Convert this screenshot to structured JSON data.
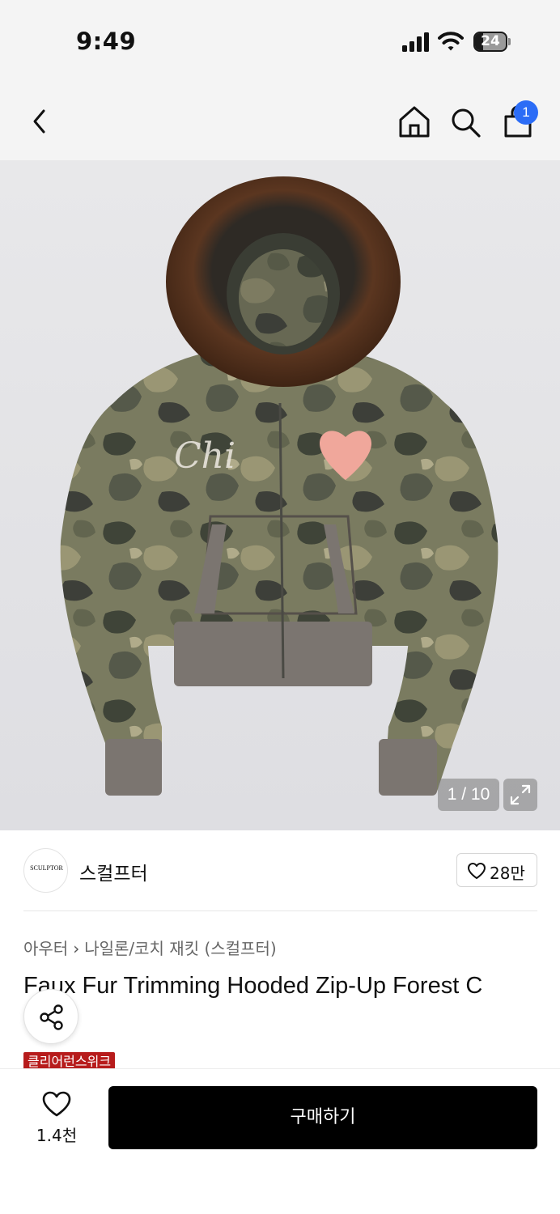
{
  "status_bar": {
    "time": "9:49",
    "battery_level": "24",
    "icons": [
      "cellular-signal-icon",
      "wifi-icon",
      "battery-icon"
    ]
  },
  "nav": {
    "icons": [
      "back-icon",
      "home-icon",
      "search-icon",
      "shopping-bag-icon"
    ],
    "cart_count": "1"
  },
  "gallery": {
    "counter": "1 / 10",
    "image_description_icon": "camo-fur-hooded-jacket-image",
    "expand_icon": "expand-icon",
    "print_text": "Chi"
  },
  "brand": {
    "logo_text": "SCULPTOR",
    "name": "스컬프터",
    "like_count": "28만"
  },
  "product": {
    "breadcrumb": [
      "아우터",
      "나일론/코치 재킷 (스컬프터)"
    ],
    "title": "Faux Fur Trimming Hooded Zip-Up Forest C",
    "promo_badge": "클리어런스위크"
  },
  "bottom_bar": {
    "wish_count": "1.4천",
    "buy_label": "구매하기"
  },
  "colors": {
    "accent_badge": "#2b6cf6",
    "promo_red": "#b71c1c",
    "buy_button": "#000000"
  }
}
